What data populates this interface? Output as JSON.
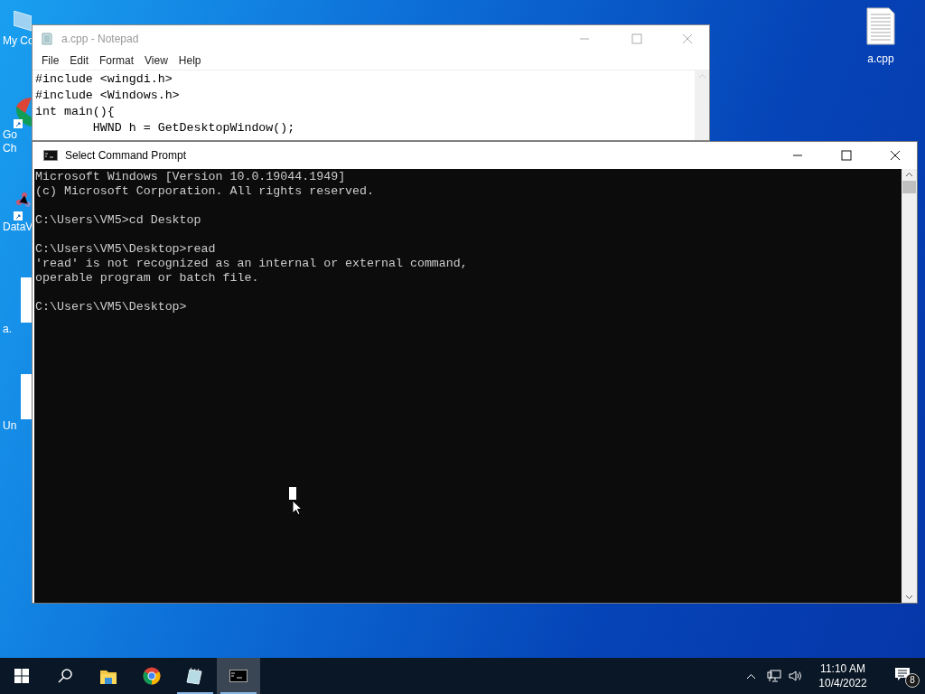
{
  "desktop": {
    "left_icons": [
      {
        "kind": "computer",
        "label_lines": [
          "My Co"
        ]
      },
      {
        "kind": "chrome",
        "label_lines": [
          "Go",
          "Ch"
        ]
      },
      {
        "kind": "molecule",
        "label_lines": [
          "DataV"
        ]
      },
      {
        "kind": "file",
        "label_lines": [
          "a."
        ]
      },
      {
        "kind": "file",
        "label_lines": [
          "Un"
        ]
      }
    ],
    "right_icons": [
      {
        "kind": "file",
        "label": "a.cpp"
      }
    ]
  },
  "notepad": {
    "title": "a.cpp - Notepad",
    "menu": [
      "File",
      "Edit",
      "Format",
      "View",
      "Help"
    ],
    "lines": [
      "#include <wingdi.h>",
      "#include <Windows.h>",
      "int main(){",
      "\tHWND h = GetDesktopWindow();"
    ]
  },
  "cmd": {
    "title": "Select Command Prompt",
    "blocks": [
      [
        "Microsoft Windows [Version 10.0.19044.1949]",
        "(c) Microsoft Corporation. All rights reserved."
      ],
      [
        "C:\\Users\\VM5>cd Desktop"
      ],
      [
        "C:\\Users\\VM5\\Desktop>read",
        "'read' is not recognized as an internal or external command,",
        "operable program or batch file."
      ],
      [
        "C:\\Users\\VM5\\Desktop>"
      ]
    ]
  },
  "taskbar": {
    "apps": [
      {
        "kind": "explorer",
        "running": false,
        "selected": false
      },
      {
        "kind": "chrome",
        "running": false,
        "selected": false
      },
      {
        "kind": "notepad",
        "running": true,
        "selected": false
      },
      {
        "kind": "cmd",
        "running": true,
        "selected": true
      }
    ],
    "clock": {
      "time": "11:10 AM",
      "date": "10/4/2022"
    },
    "notifications": {
      "count": "8"
    }
  }
}
